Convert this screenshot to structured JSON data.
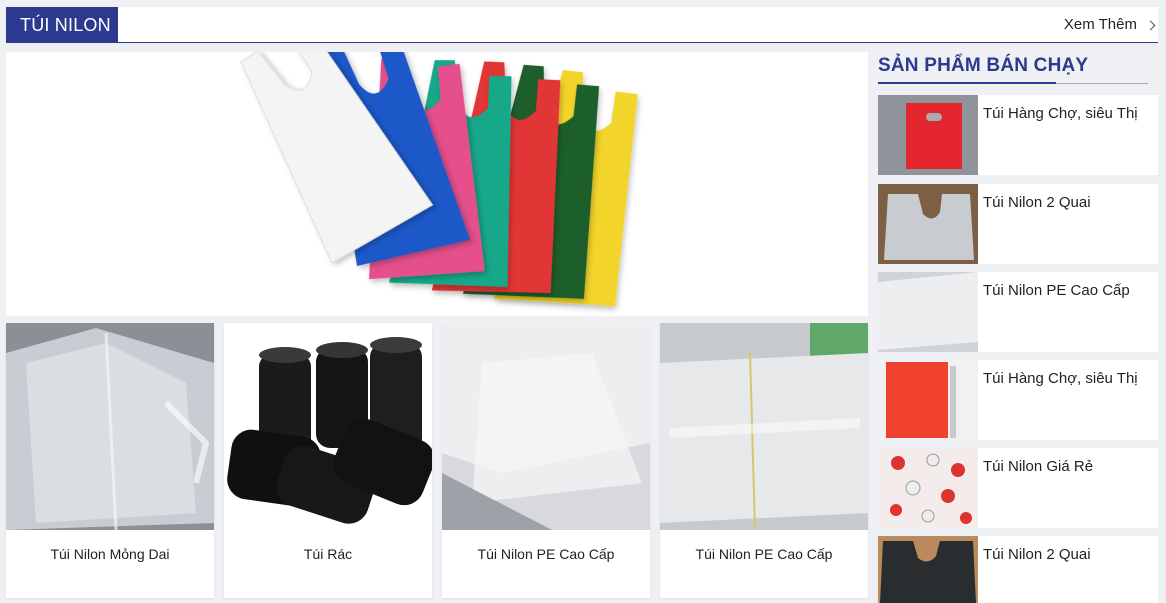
{
  "header": {
    "category_label": "TÚI NILON",
    "more_label": "Xem Thêm",
    "accent_color": "#2b3a8f"
  },
  "hero": {
    "icon": "colorful-plastic-bags-image",
    "bag_colors": [
      "#f2f2f2",
      "#1f58c8",
      "#e54f8c",
      "#19a889",
      "#e23434",
      "#1f5f2c",
      "#f3d42a"
    ]
  },
  "products": [
    {
      "name": "Túi Nilon Mỏng Dai"
    },
    {
      "name": "Túi Rác"
    },
    {
      "name": "Túi Nilon PE Cao Cấp"
    },
    {
      "name": "Túi Nilon PE Cao Cấp"
    }
  ],
  "sidebar": {
    "title": "SẢN PHẨM BÁN CHẠY",
    "items": [
      {
        "name": "Túi Hàng Chợ, siêu Thị"
      },
      {
        "name": "Túi Nilon 2 Quai"
      },
      {
        "name": "Túi Nilon PE Cao Cấp"
      },
      {
        "name": "Túi Hàng Chợ, siêu Thị"
      },
      {
        "name": "Túi Nilon Giá Rẻ"
      },
      {
        "name": "Túi Nilon 2 Quai"
      }
    ]
  }
}
